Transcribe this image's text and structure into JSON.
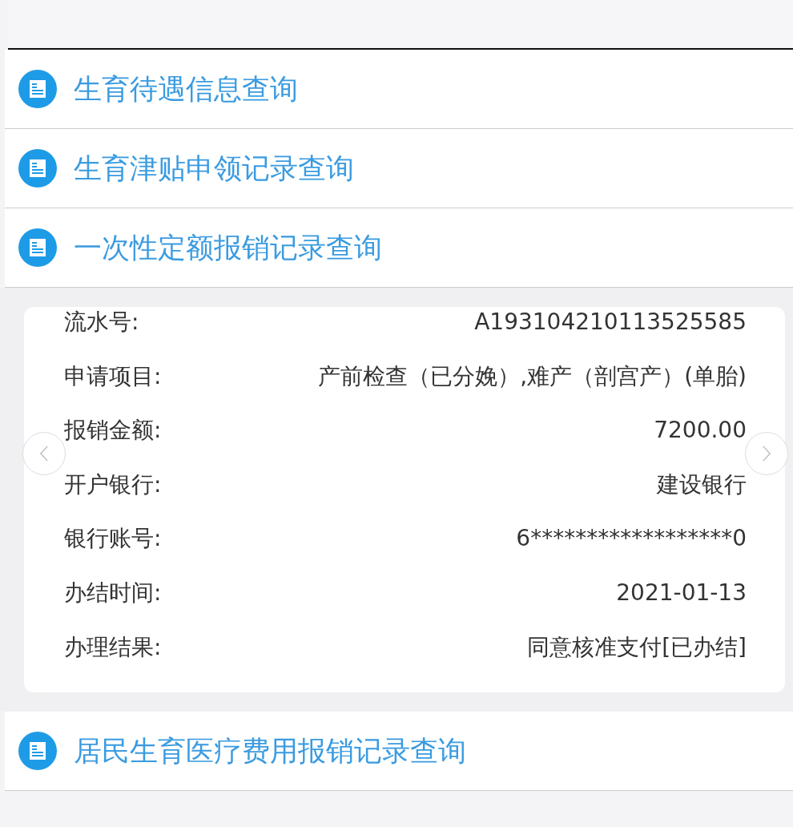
{
  "sections": [
    {
      "title": "生育待遇信息查询"
    },
    {
      "title": "生育津贴申领记录查询"
    },
    {
      "title": "一次性定额报销记录查询",
      "record": [
        {
          "label": "流水号:",
          "value": "A193104210113525585"
        },
        {
          "label": "申请项目:",
          "value": "产前检查（已分娩）,难产（剖宫产）(单胎)"
        },
        {
          "label": "报销金额:",
          "value": "7200.00"
        },
        {
          "label": "开户银行:",
          "value": "建设银行"
        },
        {
          "label": "银行账号:",
          "value": "6******************0"
        },
        {
          "label": "办结时间:",
          "value": "2021-01-13"
        },
        {
          "label": "办理结果:",
          "value": "同意核准支付[已办结]"
        }
      ]
    },
    {
      "title": "居民生育医疗费用报销记录查询"
    }
  ]
}
